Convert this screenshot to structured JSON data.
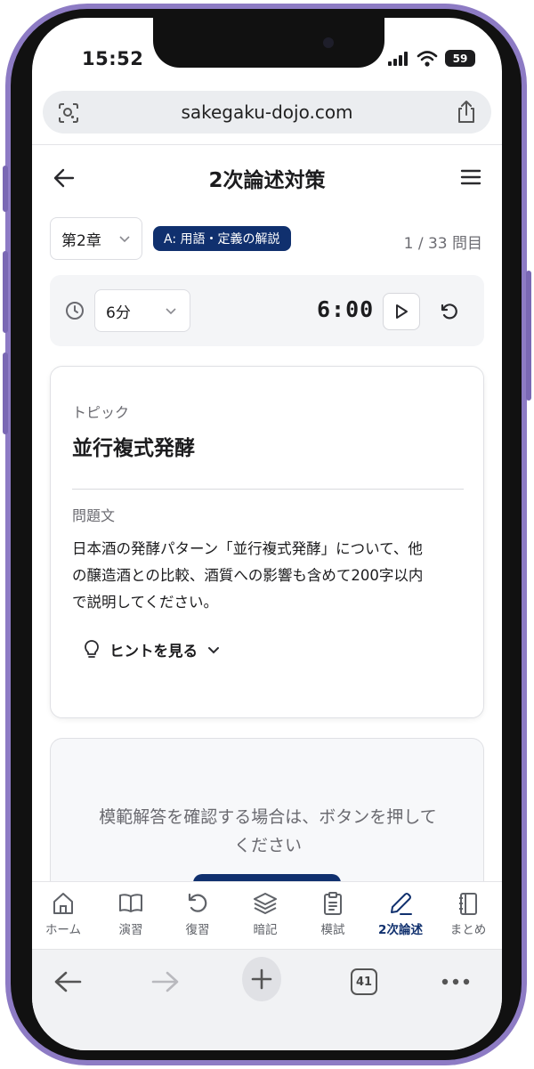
{
  "status_bar": {
    "time": "15:52",
    "battery": "59"
  },
  "browser": {
    "url": "sakegaku-dojo.com",
    "tab_count": "41"
  },
  "header": {
    "title": "2次論述対策"
  },
  "filters": {
    "chapter": "第2章",
    "category": "A: 用語・定義の解説",
    "progress": "1 / 33 問目"
  },
  "timer": {
    "duration": "6分",
    "display": "6:00"
  },
  "question_card": {
    "topic_label": "トピック",
    "topic": "並行複式発酵",
    "question_label": "問題文",
    "question_lines": [
      "日本酒の発酵パターン「並行複式発酵」について、他",
      "の醸造酒との比較、酒質への影響も含めて200字以内",
      "で説明してください。"
    ],
    "hint_label": "ヒントを見る"
  },
  "answer_card": {
    "lines": [
      "模範解答を確認する場合は、ボタンを押して",
      "ください"
    ]
  },
  "tabbar": {
    "items": [
      {
        "label": "ホーム",
        "icon": "home-icon"
      },
      {
        "label": "演習",
        "icon": "book-open-icon"
      },
      {
        "label": "復習",
        "icon": "rotate-icon"
      },
      {
        "label": "暗記",
        "icon": "layers-icon"
      },
      {
        "label": "模試",
        "icon": "clipboard-icon"
      },
      {
        "label": "2次論述",
        "icon": "pen-icon",
        "active": true
      },
      {
        "label": "まとめ",
        "icon": "notebook-icon"
      }
    ]
  },
  "colors": {
    "primary": "#10306e",
    "frame": "#8d7bc4"
  }
}
